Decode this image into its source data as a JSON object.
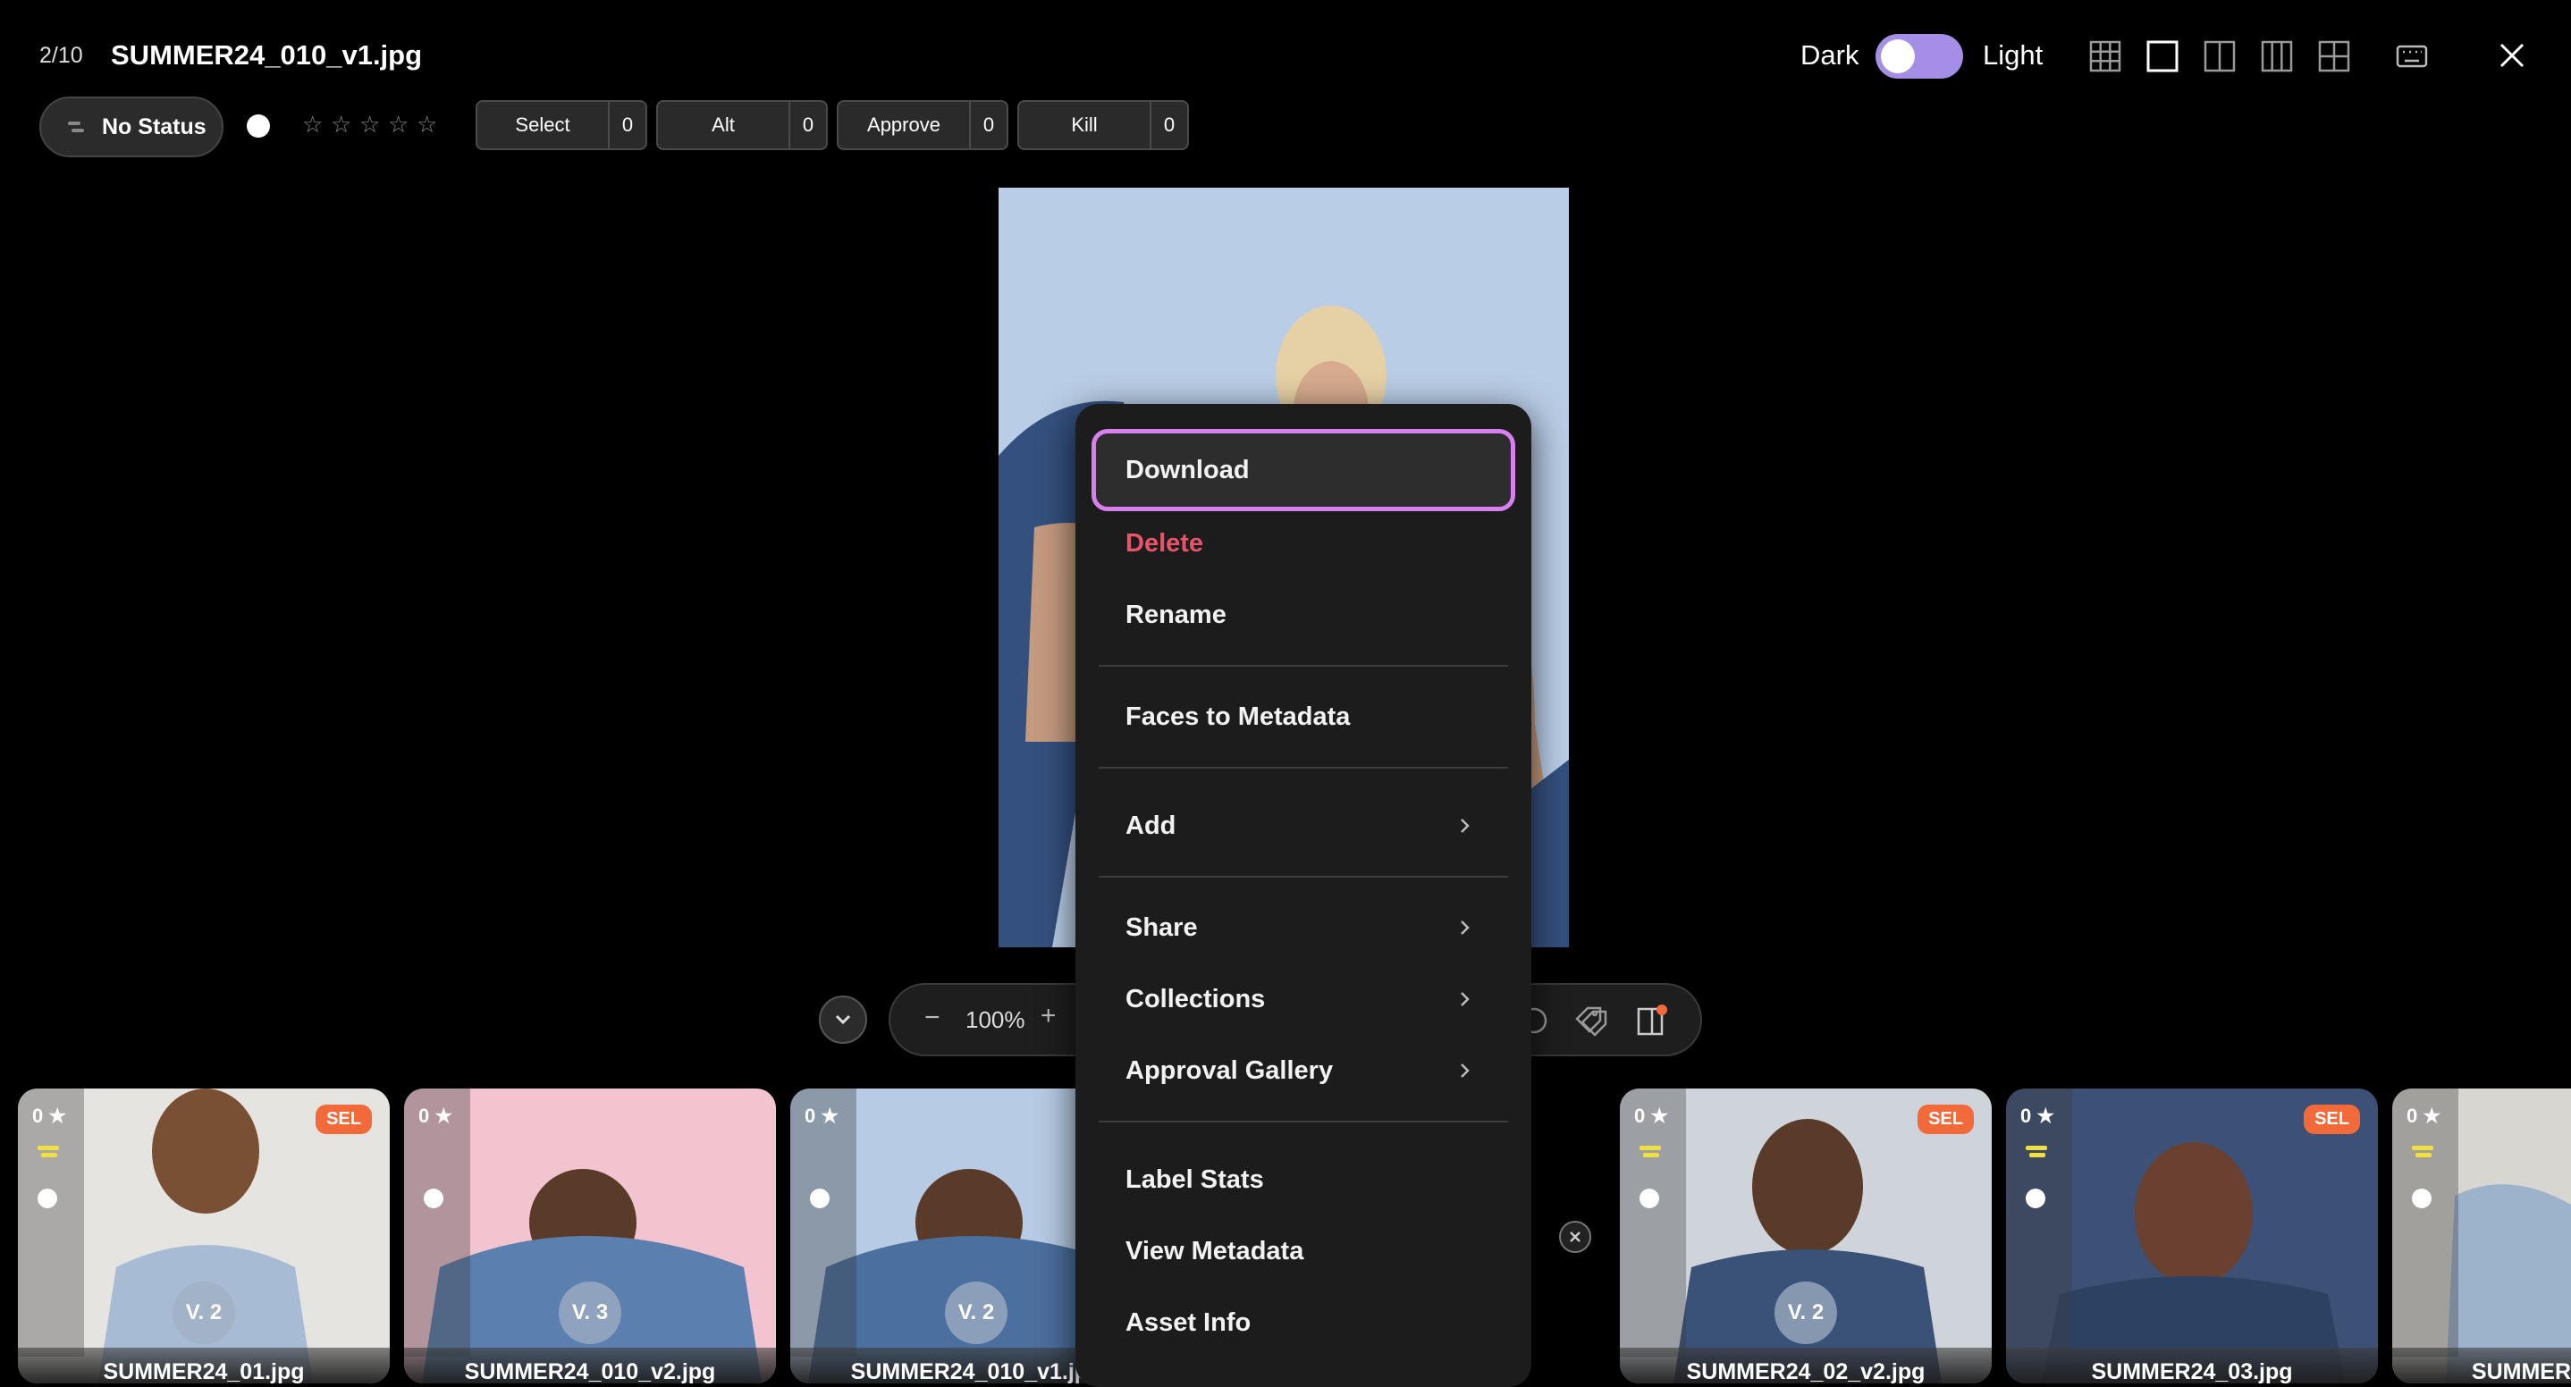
{
  "header": {
    "counter": "2/10",
    "filename": "SUMMER24_010_v1.jpg",
    "theme": {
      "dark_label": "Dark",
      "light_label": "Light"
    },
    "layout_icons": [
      "grid-layout-icon",
      "single-view-icon",
      "two-column-icon",
      "three-column-icon",
      "four-grid-icon"
    ],
    "keyboard_icon": "keyboard-icon",
    "close_icon": "close-icon"
  },
  "toolbar": {
    "status_label": "No Status",
    "stars": [
      "☆",
      "☆",
      "☆",
      "☆",
      "☆"
    ],
    "labels": [
      {
        "name": "Select",
        "count": "0"
      },
      {
        "name": "Alt",
        "count": "0"
      },
      {
        "name": "Approve",
        "count": "0"
      },
      {
        "name": "Kill",
        "count": "0"
      }
    ]
  },
  "zoom": {
    "minus": "−",
    "level": "100%",
    "plus": "+"
  },
  "context_menu": {
    "download": "Download",
    "delete": "Delete",
    "rename": "Rename",
    "faces_to_metadata": "Faces to Metadata",
    "add": "Add",
    "share": "Share",
    "collections": "Collections",
    "approval_gallery": "Approval Gallery",
    "label_stats": "Label Stats",
    "view_metadata": "View Metadata",
    "asset_info": "Asset Info",
    "colors": {
      "delete": "#e8556a",
      "focus_ring": "#d980f0"
    }
  },
  "filmstrip": [
    {
      "rating": "0 ★",
      "sel": "SEL",
      "version": "V. 2",
      "name": "SUMMER24_01.jpg"
    },
    {
      "rating": "0 ★",
      "sel": "",
      "version": "V. 3",
      "name": "SUMMER24_010_v2.jpg"
    },
    {
      "rating": "0 ★",
      "sel": "",
      "version": "V. 2",
      "name": "SUMMER24_010_v1.jpg"
    },
    {
      "rating": "0 ★",
      "sel": "SEL",
      "version": "V. 2",
      "name": "SUMMER24_02_v2.jpg"
    },
    {
      "rating": "0 ★",
      "sel": "SEL",
      "version": "",
      "name": "SUMMER24_03.jpg"
    },
    {
      "rating": "0 ★",
      "sel": "",
      "version": "",
      "name": "SUMMER"
    }
  ],
  "colors": {
    "accent_toggle": "#a48ee6",
    "sel_badge": "#f26a3a",
    "flag": "#f0e040"
  }
}
